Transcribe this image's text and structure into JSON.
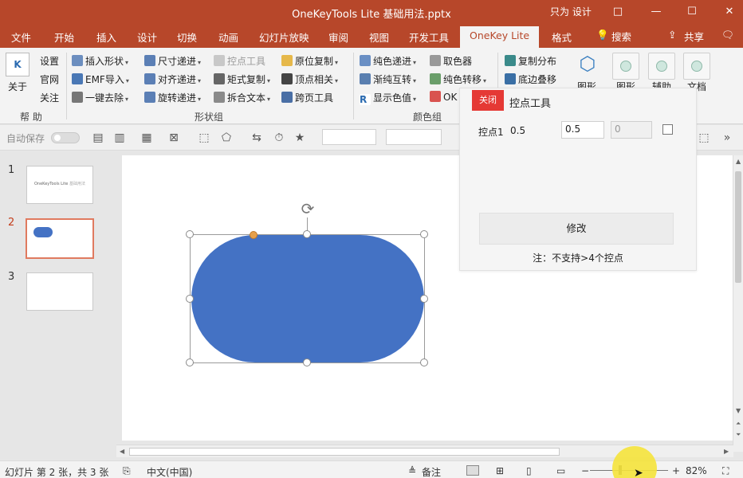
{
  "window": {
    "title": "OneKeyTools Lite 基础用法.pptx",
    "user_label": "只为 设计",
    "controls": [
      "□",
      "—",
      "☐",
      "✕"
    ]
  },
  "tabs": {
    "items": [
      "文件",
      "开始",
      "插入",
      "设计",
      "切换",
      "动画",
      "幻灯片放映",
      "审阅",
      "视图",
      "开发工具",
      "OneKey Lite",
      "格式"
    ],
    "active": "OneKey Lite",
    "search": "搜索",
    "share": "共享"
  },
  "ribbon": {
    "help_group": {
      "about": "关于",
      "settings": "设置",
      "official": "官网",
      "follow": "关注",
      "group_label": "帮 助"
    },
    "shape_group": {
      "col1": [
        "插入形状",
        "EMF导入",
        "一键去除"
      ],
      "col2": [
        "尺寸递进",
        "对齐递进",
        "旋转递进"
      ],
      "col3": [
        "控点工具",
        "矩式复制",
        "拆合文本"
      ],
      "col4": [
        "原位复制",
        "顶点相关",
        "跨页工具"
      ],
      "group_label": "形状组"
    },
    "color_group": {
      "col1": [
        "纯色递进",
        "渐纯互转",
        "显示色值"
      ],
      "col2": [
        "取色器",
        "纯色转移",
        "OK"
      ],
      "group_label": "颜色组"
    },
    "misc": {
      "copy_distribute": "复制分布",
      "base_stack": "底边叠移",
      "big_btns": [
        "图形",
        "图形",
        "辅助",
        "文档"
      ]
    }
  },
  "quickbar": {
    "autosave": "自动保存"
  },
  "thumbnails": [
    {
      "num": "1",
      "title": "OneKeyTools Lite",
      "title_suffix": "基础用法"
    },
    {
      "num": "2"
    },
    {
      "num": "3"
    }
  ],
  "panel": {
    "close_label": "关闭",
    "title": "控点工具",
    "point_label": "控点1",
    "point_value": "0.5",
    "input_value": "0.5",
    "input2_value": "0",
    "modify_label": "修改",
    "note": "注：不支持>4个控点"
  },
  "status": {
    "slide_info": "幻灯片 第 2 张，共 3 张",
    "language": "中文(中国)",
    "notes": "备注",
    "zoom": "82%"
  },
  "colors": {
    "accent": "#b7472a",
    "shape_fill": "#4472c4",
    "close_button": "#e53935"
  }
}
